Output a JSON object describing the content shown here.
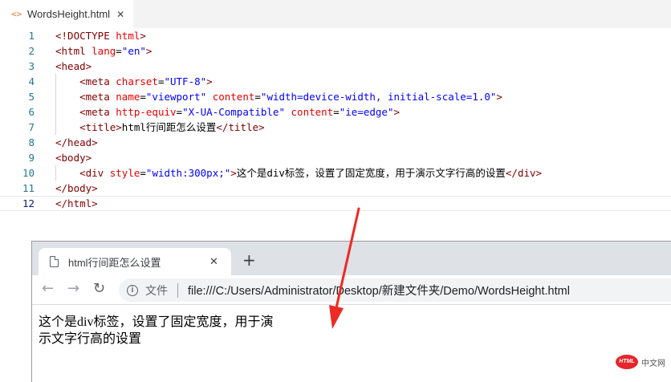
{
  "editor": {
    "tab": {
      "icon": "<>",
      "filename": "WordsHeight.html",
      "close": "✕"
    },
    "lines": [
      {
        "n": "1",
        "parts": [
          {
            "c": "t",
            "v": "<!DOCTYPE "
          },
          {
            "c": "a",
            "v": "html"
          },
          {
            "c": "t",
            "v": ">"
          }
        ]
      },
      {
        "n": "2",
        "parts": [
          {
            "c": "t",
            "v": "<html "
          },
          {
            "c": "a",
            "v": "lang"
          },
          {
            "c": "p",
            "v": "="
          },
          {
            "c": "s",
            "v": "\"en\""
          },
          {
            "c": "t",
            "v": ">"
          }
        ]
      },
      {
        "n": "3",
        "parts": [
          {
            "c": "t",
            "v": "<head>"
          }
        ]
      },
      {
        "n": "4",
        "parts": [
          {
            "c": "p",
            "v": "    "
          },
          {
            "c": "t",
            "v": "<meta "
          },
          {
            "c": "a",
            "v": "charset"
          },
          {
            "c": "p",
            "v": "="
          },
          {
            "c": "s",
            "v": "\"UTF-8\""
          },
          {
            "c": "t",
            "v": ">"
          }
        ]
      },
      {
        "n": "5",
        "parts": [
          {
            "c": "p",
            "v": "    "
          },
          {
            "c": "t",
            "v": "<meta "
          },
          {
            "c": "a",
            "v": "name"
          },
          {
            "c": "p",
            "v": "="
          },
          {
            "c": "s",
            "v": "\"viewport\""
          },
          {
            "c": "p",
            "v": " "
          },
          {
            "c": "a",
            "v": "content"
          },
          {
            "c": "p",
            "v": "="
          },
          {
            "c": "s",
            "v": "\"width=device-width, initial-scale=1.0\""
          },
          {
            "c": "t",
            "v": ">"
          }
        ]
      },
      {
        "n": "6",
        "parts": [
          {
            "c": "p",
            "v": "    "
          },
          {
            "c": "t",
            "v": "<meta "
          },
          {
            "c": "a",
            "v": "http-equiv"
          },
          {
            "c": "p",
            "v": "="
          },
          {
            "c": "s",
            "v": "\"X-UA-Compatible\""
          },
          {
            "c": "p",
            "v": " "
          },
          {
            "c": "a",
            "v": "content"
          },
          {
            "c": "p",
            "v": "="
          },
          {
            "c": "s",
            "v": "\"ie=edge\""
          },
          {
            "c": "t",
            "v": ">"
          }
        ]
      },
      {
        "n": "7",
        "parts": [
          {
            "c": "p",
            "v": "    "
          },
          {
            "c": "t",
            "v": "<title>"
          },
          {
            "c": "p",
            "v": "html行间距怎么设置"
          },
          {
            "c": "t",
            "v": "</title>"
          }
        ]
      },
      {
        "n": "8",
        "parts": [
          {
            "c": "t",
            "v": "</head>"
          }
        ]
      },
      {
        "n": "9",
        "parts": [
          {
            "c": "t",
            "v": "<body>"
          }
        ]
      },
      {
        "n": "10",
        "parts": [
          {
            "c": "p",
            "v": "    "
          },
          {
            "c": "t",
            "v": "<div "
          },
          {
            "c": "a",
            "v": "style"
          },
          {
            "c": "p",
            "v": "="
          },
          {
            "c": "s",
            "v": "\"width:300px;\""
          },
          {
            "c": "t",
            "v": ">"
          },
          {
            "c": "p",
            "v": "这个是div标签，设置了固定宽度，用于演示文字行高的设置"
          },
          {
            "c": "t",
            "v": "</div>"
          }
        ]
      },
      {
        "n": "11",
        "parts": [
          {
            "c": "t",
            "v": "</body>"
          }
        ]
      },
      {
        "n": "12",
        "parts": [
          {
            "c": "t",
            "v": "</html>"
          }
        ]
      }
    ]
  },
  "browser": {
    "tab_title": "html行间距怎么设置",
    "tab_close": "✕",
    "new_tab": "+",
    "nav": {
      "back": "←",
      "forward": "→",
      "reload": "↻"
    },
    "info_icon": "i",
    "scheme_label": "文件",
    "url": "file:///C:/Users/Administrator/Desktop/新建文件夹/Demo/WordsHeight.html",
    "content_text": "这个是div标签，设置了固定宽度，用于演示文字行高的设置"
  },
  "annotation": {
    "arrow_color": "#ee2a24"
  },
  "watermark": {
    "badge": "HTML",
    "text": "中文网"
  },
  "colors": {
    "tag": "#800000",
    "attr": "#e50000",
    "string": "#0000ff",
    "line_number": "#237893"
  }
}
